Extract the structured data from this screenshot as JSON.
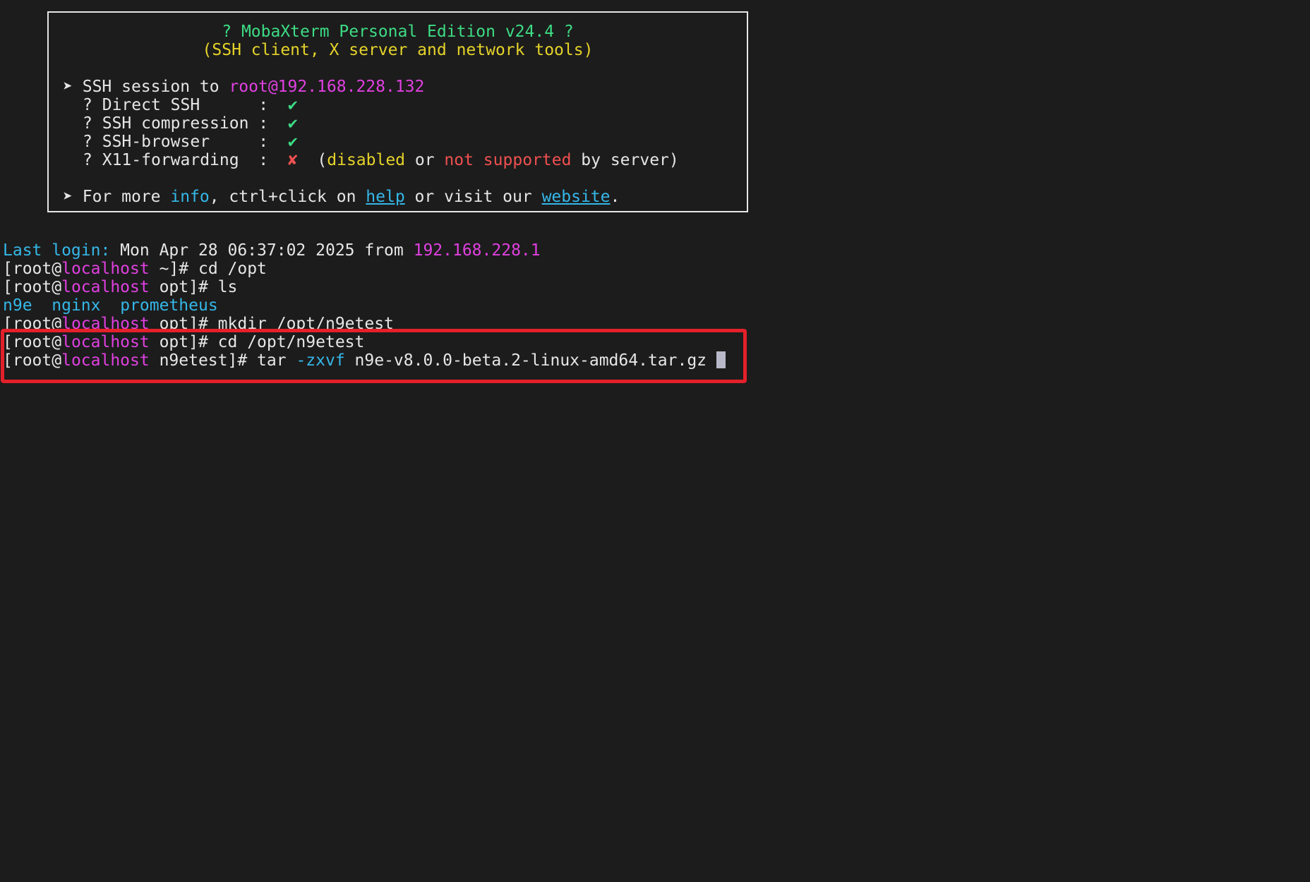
{
  "banner": {
    "title": "? MobaXterm Personal Edition v24.4 ?",
    "subtitle": "(SSH client, X server and network tools)",
    "session_arrow": "➤",
    "session_prefix": "SSH session to ",
    "session_host": "root@192.168.228.132",
    "features": [
      {
        "bullet": "?",
        "label": "Direct SSH      :",
        "status_icon": "✔"
      },
      {
        "bullet": "?",
        "label": "SSH compression :",
        "status_icon": "✔"
      },
      {
        "bullet": "?",
        "label": "SSH-browser     :",
        "status_icon": "✔"
      },
      {
        "bullet": "?",
        "label": "X11-forwarding  :",
        "status_icon": "✘"
      }
    ],
    "x11_note": {
      "open": "(",
      "disabled": "disabled",
      "or": " or ",
      "not_supported": "not supported",
      "by_server": " by server)"
    },
    "info_line": {
      "arrow": "➤",
      "prefix": "For more ",
      "info": "info",
      "mid": ", ctrl+click on ",
      "help": "help",
      "mid2": " or visit our ",
      "website": "website",
      "end": "."
    }
  },
  "session": {
    "last_login_label": "Last login:",
    "last_login_date": " Mon Apr 28 06:37:02 2025 from ",
    "last_login_ip": "192.168.228.1",
    "prompt_open": "[root@",
    "prompt_host": "localhost",
    "commands": [
      {
        "dir": " ~]# ",
        "cmd": "cd /opt"
      },
      {
        "dir": " opt]# ",
        "cmd": "ls"
      },
      {
        "dir": " opt]# ",
        "cmd": "mkdir /opt/n9etest"
      },
      {
        "dir": " opt]# ",
        "cmd": "cd /opt/n9etest"
      }
    ],
    "ls_output": [
      "n9e",
      "nginx",
      "prometheus"
    ],
    "current": {
      "dir": " n9etest]# ",
      "cmd": "tar ",
      "flag": "-zxvf",
      "arg": " n9e-v8.0.0-beta.2-linux-amd64.tar.gz "
    }
  },
  "colors": {
    "background": "#1c1c1c",
    "highlight_border": "#e4202a",
    "green": "#3ddc84",
    "yellow": "#e5d32a",
    "magenta": "#e040e0",
    "cyan": "#35b7e8",
    "red": "#f05050"
  }
}
